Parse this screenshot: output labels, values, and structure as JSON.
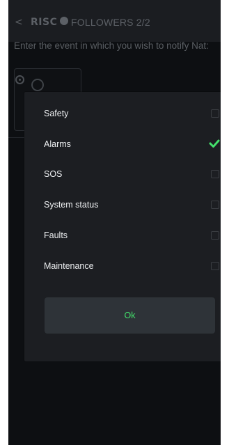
{
  "header": {
    "back_icon": "chevron-left-icon",
    "logo_text": "RISC",
    "title": "FOLLOWERS 2/2"
  },
  "prompt": "Enter the event in which you wish to notify Nat:",
  "dialog": {
    "items": [
      {
        "label": "Safety",
        "checked": false
      },
      {
        "label": "Alarms",
        "checked": true
      },
      {
        "label": "SOS",
        "checked": false
      },
      {
        "label": "System status",
        "checked": false
      },
      {
        "label": "Faults",
        "checked": false
      },
      {
        "label": "Maintenance",
        "checked": false
      }
    ],
    "ok_label": "Ok"
  },
  "colors": {
    "phone_bg": "#0d0f12",
    "dialog_bg": "#1c1e22",
    "accent_green": "#43e06b",
    "muted_text": "#5c6066"
  }
}
